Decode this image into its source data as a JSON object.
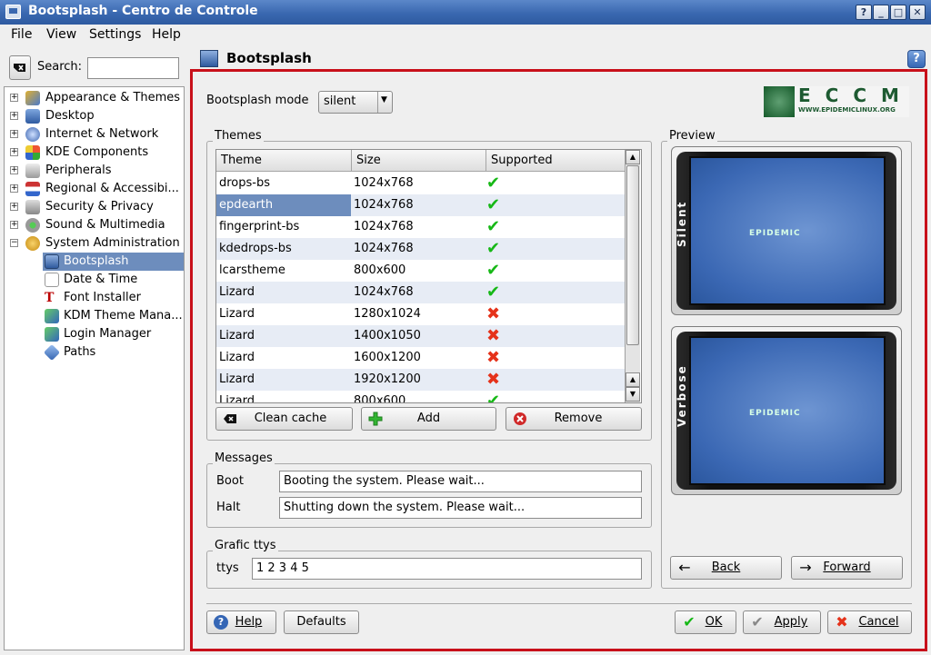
{
  "window": {
    "title": "Bootsplash - Centro de Controle",
    "buttons": [
      "?",
      "_",
      "□",
      "✕"
    ]
  },
  "menubar": {
    "items": [
      {
        "label": "File"
      },
      {
        "label": "View"
      },
      {
        "label": "Settings"
      },
      {
        "label": "Help"
      }
    ]
  },
  "search": {
    "label": "Search:",
    "value": ""
  },
  "tree": {
    "items": [
      {
        "label": "Appearance & Themes",
        "icon": "appearance-icon"
      },
      {
        "label": "Desktop",
        "icon": "desktop-icon"
      },
      {
        "label": "Internet & Network",
        "icon": "internet-icon"
      },
      {
        "label": "KDE Components",
        "icon": "components-icon"
      },
      {
        "label": "Peripherals",
        "icon": "peripherals-icon"
      },
      {
        "label": "Regional & Accessibi...",
        "icon": "regional-icon"
      },
      {
        "label": "Security & Privacy",
        "icon": "security-icon"
      },
      {
        "label": "Sound & Multimedia",
        "icon": "sound-icon"
      },
      {
        "label": "System Administration",
        "icon": "sysadmin-icon"
      },
      {
        "label": "Bootsplash",
        "icon": "bootsplash-icon"
      },
      {
        "label": "Date & Time",
        "icon": "clock-icon"
      },
      {
        "label": "Font Installer",
        "icon": "font-icon"
      },
      {
        "label": "KDM Theme Mana...",
        "icon": "kdm-icon"
      },
      {
        "label": "Login Manager",
        "icon": "login-icon"
      },
      {
        "label": "Paths",
        "icon": "paths-icon"
      }
    ]
  },
  "main": {
    "title": "Bootsplash",
    "mode_label": "Bootsplash mode",
    "mode_value": "silent",
    "logo_text": "ECCM",
    "logo_url": "WWW.EPIDEMICLINUX.ORG",
    "themes": {
      "group_title": "Themes",
      "columns": [
        "Theme",
        "Size",
        "Supported"
      ],
      "rows": [
        {
          "theme": "drops-bs",
          "size": "1024x768",
          "supported": true
        },
        {
          "theme": "epdearth",
          "size": "1024x768",
          "supported": true,
          "selected": true
        },
        {
          "theme": "fingerprint-bs",
          "size": "1024x768",
          "supported": true
        },
        {
          "theme": "kdedrops-bs",
          "size": "1024x768",
          "supported": true
        },
        {
          "theme": "lcarstheme",
          "size": "800x600",
          "supported": true
        },
        {
          "theme": "Lizard",
          "size": "1024x768",
          "supported": true
        },
        {
          "theme": "Lizard",
          "size": "1280x1024",
          "supported": false
        },
        {
          "theme": "Lizard",
          "size": "1400x1050",
          "supported": false
        },
        {
          "theme": "Lizard",
          "size": "1600x1200",
          "supported": false
        },
        {
          "theme": "Lizard",
          "size": "1920x1200",
          "supported": false
        },
        {
          "theme": "Lizard",
          "size": "800x600",
          "supported": true
        }
      ],
      "buttons": {
        "clean": "Clean cache",
        "add": "Add",
        "remove": "Remove"
      }
    },
    "messages": {
      "group_title": "Messages",
      "boot_label": "Boot",
      "boot_value": "Booting the system. Please wait...",
      "halt_label": "Halt",
      "halt_value": "Shutting down the system. Please wait..."
    },
    "ttys": {
      "group_title": "Grafic ttys",
      "label": "ttys",
      "value": "1 2 3 4 5"
    },
    "preview": {
      "group_title": "Preview",
      "silent_label": "Silent",
      "verbose_label": "Verbose",
      "screen_logo": "EPIDEMIC",
      "back": "Back",
      "forward": "Forward"
    },
    "footer": {
      "help": "Help",
      "defaults": "Defaults",
      "ok": "OK",
      "apply": "Apply",
      "cancel": "Cancel"
    }
  },
  "colors": {
    "accent": "#6d8dbd",
    "frame": "#c8101a",
    "titlebar": "#3a68b0",
    "ok": "#16b816",
    "no": "#e5321a"
  }
}
